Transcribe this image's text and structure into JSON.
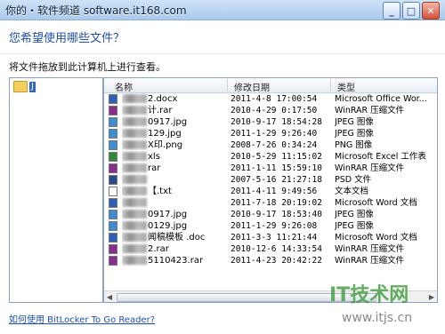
{
  "window": {
    "title_watermark": "你的・软件频道 software.it168.com",
    "buttons": [
      "minimize",
      "maximize",
      "close"
    ]
  },
  "heading": "您希望使用哪些文件？",
  "instruction": "将文件拖放到此计算机上进行查看。",
  "tree": {
    "selected_label": "J"
  },
  "list": {
    "columns": [
      "名称",
      "修改日期",
      "类型"
    ],
    "rows": [
      {
        "name": "2.docx",
        "date": "2011-4-8 17:00:54",
        "type": "Microsoft Office Wor...",
        "icon": "word"
      },
      {
        "name": "计.rar",
        "date": "2010-4-29 0:17:50",
        "type": "WinRAR 压缩文件",
        "icon": "rar"
      },
      {
        "name": "0917.jpg",
        "date": "2010-9-17 18:54:28",
        "type": "JPEG 图像",
        "icon": "image"
      },
      {
        "name": "129.jpg",
        "date": "2011-1-29 9:26:40",
        "type": "JPEG 图像",
        "icon": "image"
      },
      {
        "name": "X印.png",
        "date": "2008-7-26 0:34:24",
        "type": "PNG 图像",
        "icon": "image"
      },
      {
        "name": "xls",
        "date": "2010-5-29 11:15:02",
        "type": "Microsoft Excel 工作表",
        "icon": "excel"
      },
      {
        "name": "rar",
        "date": "2011-1-11 15:59:10",
        "type": "WinRAR 压缩文件",
        "icon": "rar"
      },
      {
        "name": "",
        "date": "2007-5-16 21:27:18",
        "type": "PSD 文件",
        "icon": "psd"
      },
      {
        "name": "【.txt",
        "date": "2011-4-11 9:49:56",
        "type": "文本文档",
        "icon": "text"
      },
      {
        "name": "",
        "date": "2011-7-18 20:19:02",
        "type": "Microsoft Word 文档",
        "icon": "word"
      },
      {
        "name": "0917.jpg",
        "date": "2010-9-17 18:53:40",
        "type": "JPEG 图像",
        "icon": "image"
      },
      {
        "name": "0129.jpg",
        "date": "2011-1-29 9:26:08",
        "type": "JPEG 图像",
        "icon": "image"
      },
      {
        "name": "闻稿模板 .doc",
        "date": "2011-3-3 11:21:44",
        "type": "Microsoft Word 文档",
        "icon": "word"
      },
      {
        "name": "2.rar",
        "date": "2010-12-6 14:33:54",
        "type": "WinRAR 压缩文件",
        "icon": "rar"
      },
      {
        "name": "5110423.rar",
        "date": "2011-4-23 20:42:22",
        "type": "WinRAR 压缩文件",
        "icon": "rar"
      }
    ]
  },
  "footer_link": "如何使用 BitLocker To Go Reader?",
  "watermark": {
    "logo": "IT技术网",
    "url": "www.itjs.cn"
  },
  "colors": {
    "accent": "#2151a3",
    "selection": "#316ac5",
    "link": "#1a4fb5"
  }
}
